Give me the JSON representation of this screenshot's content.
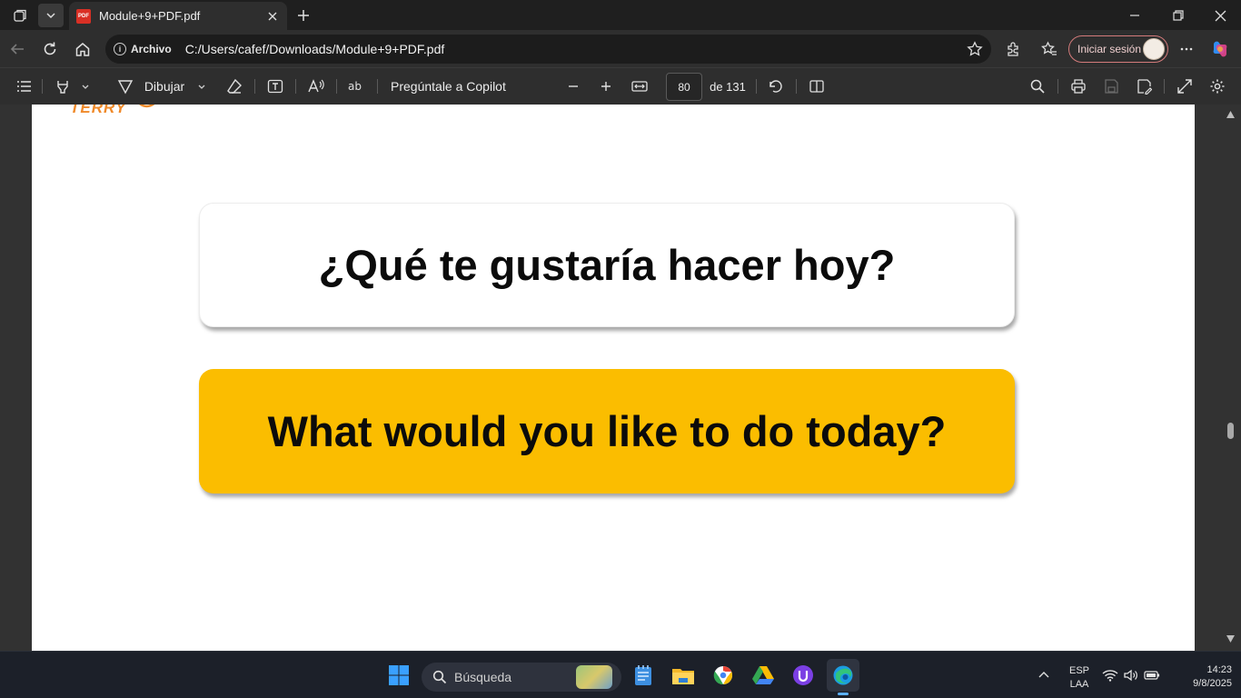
{
  "browser": {
    "tab": {
      "title": "Module+9+PDF.pdf",
      "favicon_text": "PDF"
    },
    "address": {
      "security_label": "Archivo",
      "url": "C:/Users/cafef/Downloads/Module+9+PDF.pdf"
    },
    "profile": {
      "signin_label": "Iniciar sesión"
    }
  },
  "pdf_toolbar": {
    "draw_label": "Dibujar",
    "copilot_label": "Pregúntale a Copilot",
    "page_number": "80",
    "page_total": "de 131"
  },
  "document": {
    "logo_text": "TERRY",
    "card_spanish": "¿Qué te gustaría hacer hoy?",
    "card_english": "What would you like to do today?",
    "colors": {
      "card_highlight": "#fbbd00",
      "logo": "#f08a2a"
    }
  },
  "taskbar": {
    "search_placeholder": "Búsqueda",
    "language_top": "ESP",
    "language_bottom": "LAA",
    "time": "14:23",
    "date": "9/8/2025"
  }
}
